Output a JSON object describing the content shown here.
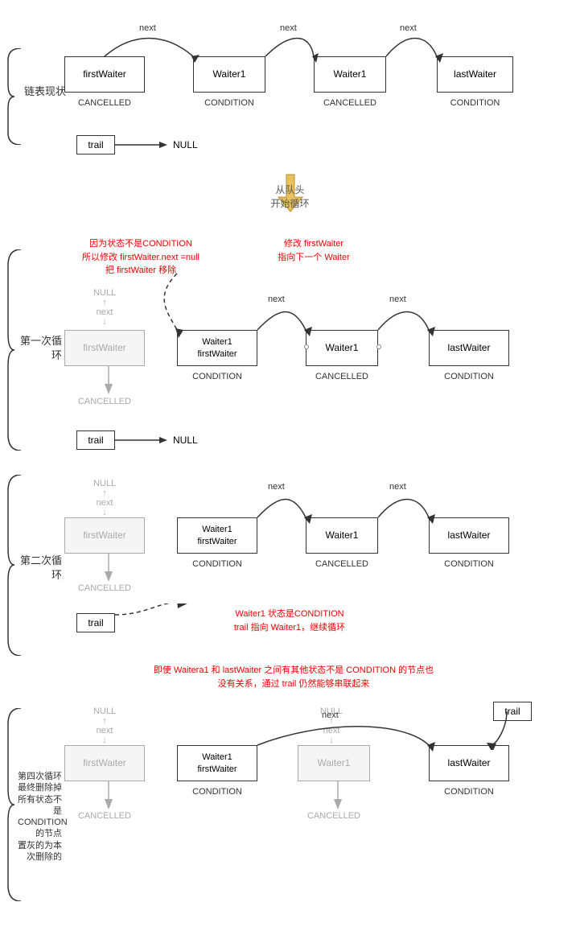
{
  "sections": {
    "chain_state": "链表现状",
    "loop_start": "从队头\n开始循环",
    "first_loop": "第一次循环",
    "second_loop": "第二次循环",
    "fourth_loop_label": "第四次循环\n最终删除掉\n所有状态不\n是\nCONDITION\n的节点\n置灰的为本\n次删除的"
  },
  "nodes": {
    "firstWaiter": "firstWaiter",
    "waiter1": "Waiter1",
    "waiter1_firstWaiter": "Waiter1\nfirstWaiter",
    "lastWaiter": "lastWaiter",
    "trail": "trail",
    "null_label": "NULL",
    "next_label": "next"
  },
  "statuses": {
    "cancelled": "CANCELLED",
    "condition": "CONDITION"
  },
  "annotations": {
    "first_loop_left": "因为状态不是CONDITION\n所以修改 firstWaiter.next =null\n把 firstWaiter 移除",
    "first_loop_right": "修改 firstWaiter\n指向下一个 Waiter",
    "second_loop_bottom": "Waiter1 状态是CONDITION\ntrail 指向 Waiter1，继续循环",
    "fourth_loop_top": "即使 Waitera1 和 lastWaiter 之间有其他状态不是 CONDITION 的节点也\n没有关系，通过 trail 仍然能够串联起来"
  },
  "colors": {
    "red": "#cc0000",
    "grey": "#aaaaaa",
    "dark": "#333333",
    "box_border": "#333333"
  }
}
